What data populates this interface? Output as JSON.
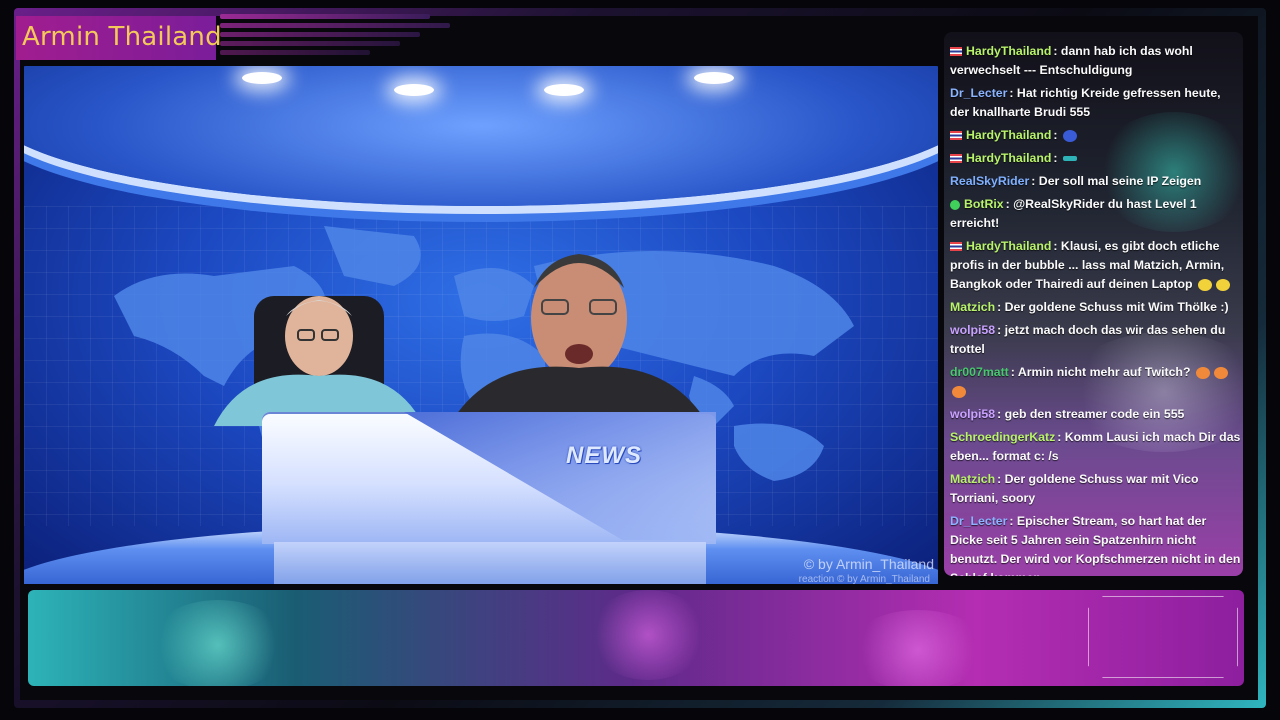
{
  "overlay": {
    "title": "Armin Thailand"
  },
  "video": {
    "desk_logo": "NEWS",
    "watermark": "© by Armin_Thailand",
    "watermark_small": "reaction  © by Armin_Thailand"
  },
  "chat": {
    "messages": [
      {
        "user": "HardyThailand",
        "text": ": dann hab ich das wohl verwechselt --- Entschuldigung",
        "color": "#b8f36a",
        "badge": "flag"
      },
      {
        "user": "Dr_Lecter",
        "text": ": Hat richtig Kreide gefressen heute, der knallharte Brudi 555",
        "color": "#8ab4ff",
        "badge": ""
      },
      {
        "user": "HardyThailand",
        "text": ":",
        "color": "#b8f36a",
        "badge": "flag"
      },
      {
        "user": "HardyThailand",
        "text": ":",
        "color": "#b8f36a",
        "badge": "flag"
      },
      {
        "user": "RealSkyRider",
        "text": ": Der soll mal seine IP Zeigen",
        "color": "#7fb0ff",
        "badge": ""
      },
      {
        "user": "BotRix",
        "text": ": @RealSkyRider du hast Level 1 erreicht!",
        "color": "#b8f36a",
        "badge": "check"
      },
      {
        "user": "HardyThailand",
        "text": ": Klausi, es gibt doch etliche profis in der bubble ... lass mal Matzich, Armin, Bangkok oder Thairedi auf deinen Laptop",
        "color": "#b8f36a",
        "badge": "flag"
      },
      {
        "user": "Matzich",
        "text": ": Der goldene Schuss mit Wim Thölke :)",
        "color": "#b8f36a",
        "badge": ""
      },
      {
        "user": "wolpi58",
        "text": ": jetzt mach doch das wir das sehen du trottel",
        "color": "#c9a2ff",
        "badge": ""
      },
      {
        "user": "dr007matt",
        "text": ": Armin nicht mehr auf Twitch?",
        "color": "#47c96d",
        "badge": ""
      },
      {
        "user": "wolpi58",
        "text": ": geb den streamer code ein 555",
        "color": "#c9a2ff",
        "badge": ""
      },
      {
        "user": "SchroedingerKatz",
        "text": ": Komm Lausi ich mach Dir das eben... format c: /s",
        "color": "#b8f36a",
        "badge": ""
      },
      {
        "user": "Matzich",
        "text": ": Der goldene Schuss war mit Vico Torriani, soory",
        "color": "#b8f36a",
        "badge": ""
      },
      {
        "user": "Dr_Lecter",
        "text": ": Epischer Stream, so hart hat der Dicke seit 5 Jahren sein Spatzenhirn nicht benutzt. Der wird vor Kopfschmerzen nicht in den Schlaf kommen",
        "color": "#8ab4ff",
        "badge": ""
      }
    ]
  },
  "colors": {
    "title": "#f3c95a",
    "accent_magenta": "#a11d8f",
    "accent_cyan": "#2fb6c0"
  }
}
